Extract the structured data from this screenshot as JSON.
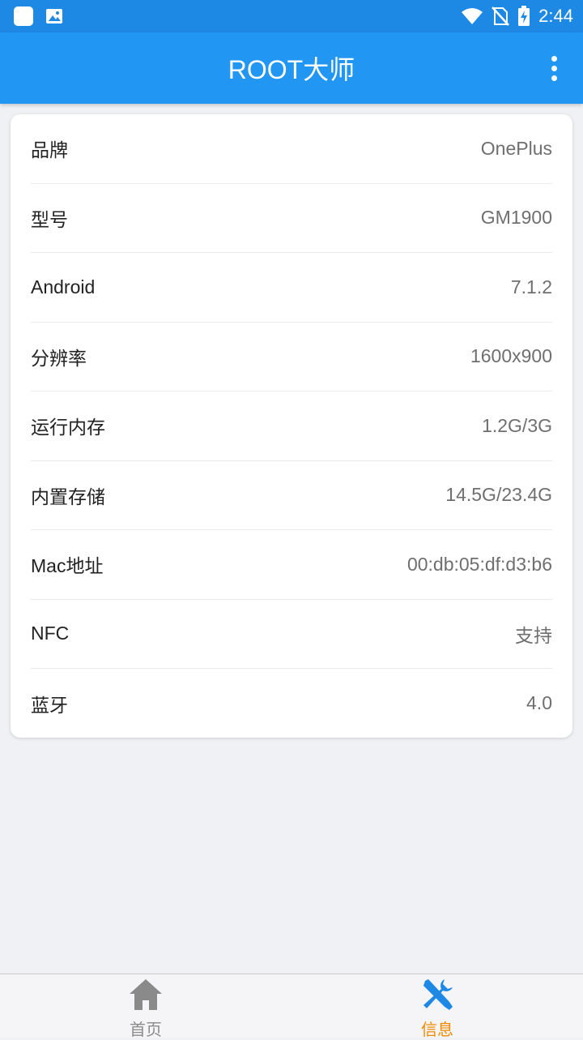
{
  "status_bar": {
    "time": "2:44",
    "left_icons": [
      "app-icon",
      "image-icon"
    ],
    "right_icons": [
      "wifi-icon",
      "no-sim-icon",
      "battery-charging-icon"
    ]
  },
  "app_bar": {
    "title": "ROOT大师",
    "menu_icon": "more-vert-icon",
    "color": "#2196f3"
  },
  "info": {
    "rows": [
      {
        "label": "品牌",
        "value": "OnePlus"
      },
      {
        "label": "型号",
        "value": "GM1900"
      },
      {
        "label": "Android",
        "value": "7.1.2"
      },
      {
        "label": "分辨率",
        "value": "1600x900"
      },
      {
        "label": "运行内存",
        "value": "1.2G/3G"
      },
      {
        "label": "内置存储",
        "value": "14.5G/23.4G"
      },
      {
        "label": "Mac地址",
        "value": "00:db:05:df:d3:b6"
      },
      {
        "label": "NFC",
        "value": "支持"
      },
      {
        "label": "蓝牙",
        "value": "4.0"
      }
    ]
  },
  "bottom_nav": {
    "items": [
      {
        "label": "首页",
        "icon": "home-icon",
        "active": false,
        "color": "#8a8a8a"
      },
      {
        "label": "信息",
        "icon": "tools-icon",
        "active": true,
        "color": "#f08a00"
      }
    ],
    "tools_icon_color": "#1e88e5"
  }
}
